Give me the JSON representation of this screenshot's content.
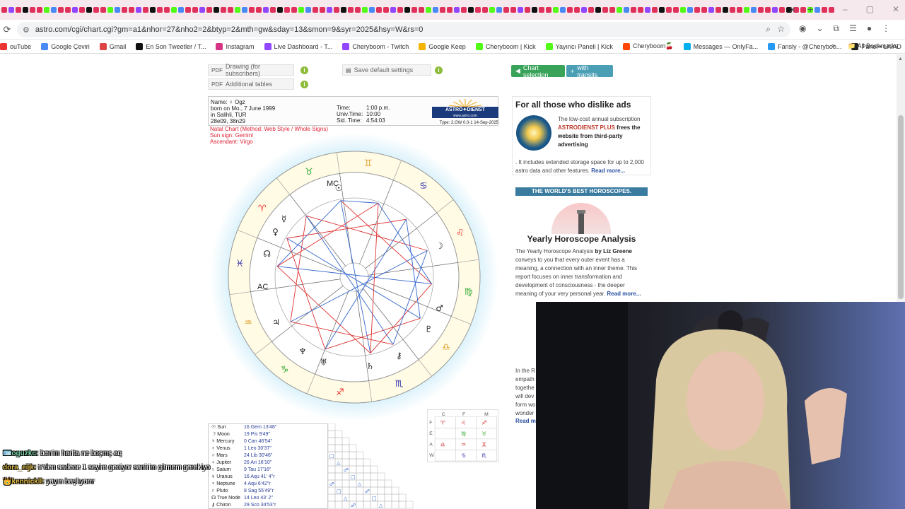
{
  "browser": {
    "url": "astro.com/cgi/chart.cgi?gm=a1&nhor=27&nho2=2&btyp=2&mth=gw&sday=13&smon=9&syr=2025&hsy=W&rs=0",
    "window_controls": [
      "–",
      "▢",
      "✕"
    ],
    "new_tab": "+",
    "tab_close": "✕",
    "bookmarks": [
      {
        "label": "ouTube",
        "color": "#e33"
      },
      {
        "label": "Google Çeviri",
        "color": "#4a8af4"
      },
      {
        "label": "Gmail",
        "color": "#d44"
      },
      {
        "label": "En Son Tweetler / T...",
        "color": "#111"
      },
      {
        "label": "Instagram",
        "color": "#d63384"
      },
      {
        "label": "Live Dashboard - T...",
        "color": "#9146ff"
      },
      {
        "label": "Cheryboom - Twitch",
        "color": "#9146ff"
      },
      {
        "label": "Google Keep",
        "color": "#f4b400"
      },
      {
        "label": "Cheryboom | Kick",
        "color": "#53fc18"
      },
      {
        "label": "Yayıncı Paneli | Kick",
        "color": "#53fc18"
      },
      {
        "label": "Cheryboom🍒",
        "color": "#ff4500"
      },
      {
        "label": "Messages — OnlyFa...",
        "color": "#00aff0"
      },
      {
        "label": "Fansly - @Cheryboo...",
        "color": "#2699f7"
      },
      {
        "label": "Panel • LIVAD",
        "color": "#222"
      }
    ],
    "all_bookmarks": "All Bookmarks"
  },
  "page": {
    "pdf_drawing": "Drawing (for subscribers)",
    "pdf_tables": "Additional tables",
    "pdf_tag": "PDF",
    "save_defaults": "Save default settings",
    "chart_selection": "Chart selection",
    "with_transits": "with transits",
    "info_mark": "i"
  },
  "chart_header": {
    "name_line": "Name: ♀ Ogz",
    "born_line": "born on Mo., 7 June 1999",
    "place_line": "in Salihli, TUR",
    "coords_line": "28e09, 38n29",
    "time_label": "Time:",
    "time_value": "1:00 p.m.",
    "univ_label": "Univ.Time:",
    "univ_value": "10:00",
    "sid_label": "Sid. Time:",
    "sid_value": "4:54:03",
    "logo_text": "ASTRO✦DIENST",
    "logo_url": "www.astro.com",
    "type_line": "Type: 2.GW  0.0-1  14-Sep-2025",
    "natal_line1": "Natal Chart  (Method: Web Style / Whole Signs)",
    "natal_line2": "Sun sign: Gemini",
    "natal_line3": "Ascendant: Virgo"
  },
  "wheel_labels": {
    "mc": "MC",
    "ac": "AC"
  },
  "planets": [
    {
      "sym": "☉",
      "name": "Sun",
      "pos": "16 Gem 13'48\""
    },
    {
      "sym": "☽",
      "name": "Moon",
      "pos": "19 Pis  9'49\""
    },
    {
      "sym": "☿",
      "name": "Mercury",
      "pos": "0 Can 46'54\""
    },
    {
      "sym": "♀",
      "name": "Venus",
      "pos": "1 Leo 30'37\""
    },
    {
      "sym": "♂",
      "name": "Mars",
      "pos": "24 Lib 30'46\""
    },
    {
      "sym": "♃",
      "name": "Jupiter",
      "pos": "26 Ari 16'10\""
    },
    {
      "sym": "♄",
      "name": "Saturn",
      "pos": "9 Tau 17'16\""
    },
    {
      "sym": "♅",
      "name": "Uranus",
      "pos": "16 Aqu 41' 4\"r"
    },
    {
      "sym": "♆",
      "name": "Neptune",
      "pos": "4 Aqu  6'42\"r"
    },
    {
      "sym": "♇",
      "name": "Pluto",
      "pos": "8 Sag 55'49\"r"
    },
    {
      "sym": "☊",
      "name": "True Node",
      "pos": "14 Leo 43'  2\""
    },
    {
      "sym": "⚷",
      "name": "Chiron",
      "pos": "29 Sco 34'53\"r"
    }
  ],
  "aspect_grid_headers": [
    "C",
    "F",
    "M"
  ],
  "aspect_grid_rows": [
    "F",
    "E",
    "A",
    "W"
  ],
  "sidebar": {
    "ad1_title": "For all those who dislike ads",
    "ad1_text_a": "The low-cost annual subscription ",
    "ad1_text_red": "ASTRODIENST PLUS",
    "ad1_text_b": " frees the website from third-party advertising",
    "ad1_text_c": ". It includes extended storage space for up to 2,000 astro data and other features. ",
    "ad1_more": "Read more...",
    "ad2_banner": "THE WORLD'S BEST HOROSCOPES.",
    "ad2_title": "Yearly Horoscope Analysis",
    "ad2_text_a": "The Yearly Horoscope Analysis ",
    "ad2_text_bold": "by Liz Greene",
    "ad2_text_b": " conveys to you that every outer event has a meaning, a connection with an inner theme. This report focuses on inner transformation and development of consciousness - the deeper meaning of your very personal year. ",
    "ad2_more": "Read more...",
    "ad3_text": "In the R empath togethe will dev form wo wonder",
    "ad3_more": "Read m"
  },
  "chat": [
    {
      "user": "oguzkc:",
      "msg": " benim harita ne boşmş aq",
      "badge": "🪪"
    },
    {
      "user": "dora_eijk:",
      "msg": " tr'den sadece 1 seyim geciyor sanirim gitmem gerekiyo",
      "badge": ""
    },
    {
      "user": "kennickll:",
      "msg": " yayın başlıyorrr",
      "badge": "👑"
    }
  ]
}
